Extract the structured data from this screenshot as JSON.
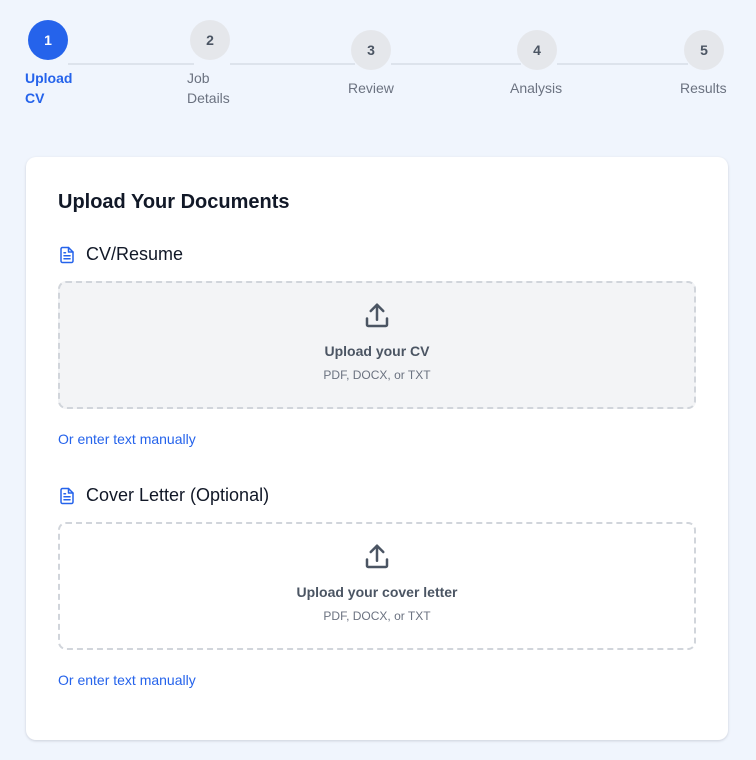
{
  "stepper": {
    "steps": [
      {
        "number": "1",
        "label": "Upload\nCV",
        "active": true
      },
      {
        "number": "2",
        "label": "Job\nDetails",
        "active": false
      },
      {
        "number": "3",
        "label": "Review",
        "active": false
      },
      {
        "number": "4",
        "label": "Analysis",
        "active": false
      },
      {
        "number": "5",
        "label": "Results",
        "active": false
      }
    ]
  },
  "card": {
    "title": "Upload Your Documents",
    "cv": {
      "section_title": "CV/Resume",
      "drop_title": "Upload your CV",
      "drop_formats": "PDF, DOCX, or TXT",
      "manual_link": "Or enter text manually"
    },
    "cover_letter": {
      "section_title": "Cover Letter (Optional)",
      "drop_title": "Upload your cover letter",
      "drop_formats": "PDF, DOCX, or TXT",
      "manual_link": "Or enter text manually"
    }
  },
  "colors": {
    "accent": "#2563eb",
    "background": "#f0f5fd",
    "card": "#ffffff"
  },
  "icons": {
    "section": "file-text-icon",
    "dropzone": "upload-icon"
  }
}
